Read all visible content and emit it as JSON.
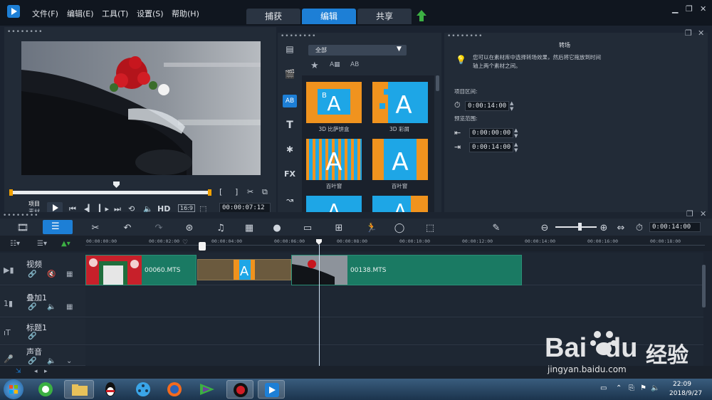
{
  "menu": [
    "文件(F)",
    "编辑(E)",
    "工具(T)",
    "设置(S)",
    "帮助(H)"
  ],
  "main_tabs": [
    "捕获",
    "编辑",
    "共享"
  ],
  "preview": {
    "project_label": "项目",
    "clip_label": "素材",
    "hd_label": "HD",
    "timecode": "00:00:07:12"
  },
  "library": {
    "filter": "全部",
    "thumbs": [
      {
        "label": "3D 比萨饼盒"
      },
      {
        "label": "3D 彩屑"
      },
      {
        "label": "百叶窗"
      },
      {
        "label": "百叶窗"
      }
    ]
  },
  "options": {
    "title": "转场",
    "tip": "您可以在素材库中选择转场效果，然后将它拖放到时间轴上两个素材之间。",
    "project_range_label": "项目区间:",
    "project_range": "0:00:14:00",
    "preview_range_label": "预览范围:",
    "preview_start": "0:00:00:00",
    "preview_end": "0:00:14:00"
  },
  "timeline": {
    "duration": "0:00:14:00",
    "ruler": [
      "00:00:00:00",
      "00:00:02:00",
      "00:00:04:00",
      "00:00:06:00",
      "00:00:08:00",
      "00:00:10:00",
      "00:00:12:00",
      "00:00:14:00",
      "00:00:16:00",
      "00:00:18:00"
    ],
    "tracks": [
      "视频",
      "叠加1",
      "标题1",
      "声音"
    ],
    "clips": [
      "00060.MTS",
      "00138.MTS"
    ]
  },
  "taskbar": {
    "time": "22:09",
    "date": "2018/9/27"
  },
  "watermark": {
    "brand": "Bai",
    "brand2": "du",
    "cn": "经验",
    "url": "jingyan.baidu.com"
  },
  "colors": {
    "accent": "#1d7fd6",
    "clip_green": "#1a7a63",
    "bg": "#1b2330"
  }
}
